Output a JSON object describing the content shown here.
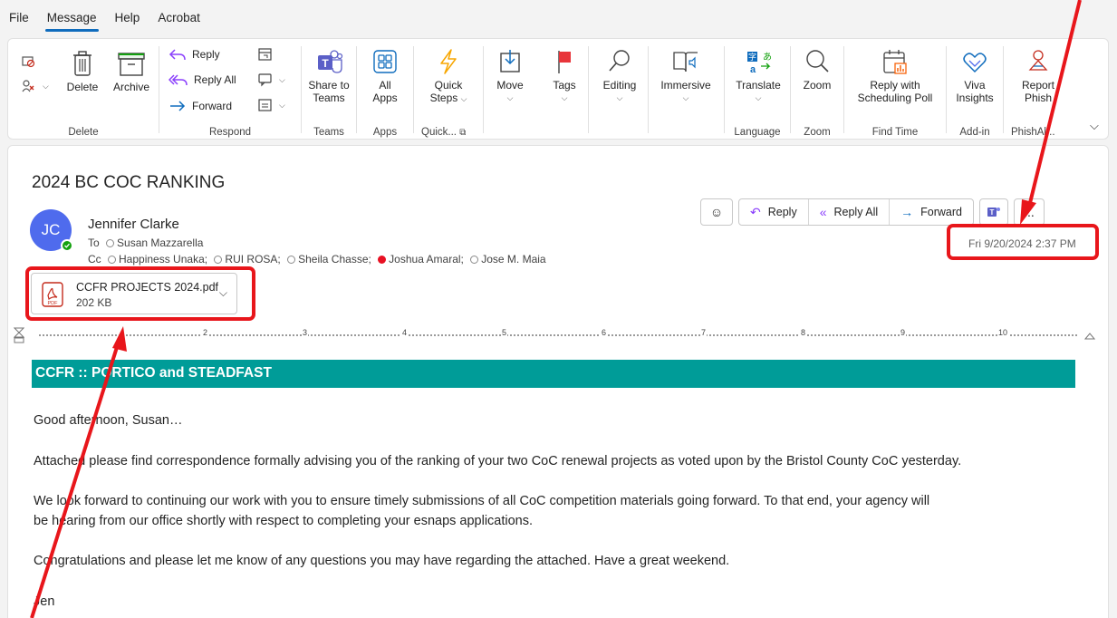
{
  "menu": {
    "tabs": [
      "File",
      "Message",
      "Help",
      "Acrobat"
    ],
    "active": "Message"
  },
  "ribbon": {
    "groups": {
      "delete": "Delete",
      "respond": "Respond",
      "teams": "Teams",
      "apps": "Apps",
      "quick": "Quick...",
      "language": "Language",
      "zoom": "Zoom",
      "findtime": "Find Time",
      "addin": "Add-in",
      "phish": "PhishAl..."
    },
    "buttons": {
      "delete": "Delete",
      "archive": "Archive",
      "reply": "Reply",
      "reply_all": "Reply All",
      "forward": "Forward",
      "share_teams_1": "Share to",
      "share_teams_2": "Teams",
      "all_apps_1": "All",
      "all_apps_2": "Apps",
      "quick_steps_1": "Quick",
      "quick_steps_2": "Steps",
      "move": "Move",
      "tags": "Tags",
      "editing": "Editing",
      "immersive": "Immersive",
      "translate": "Translate",
      "zoom": "Zoom",
      "reply_poll_1": "Reply with",
      "reply_poll_2": "Scheduling Poll",
      "viva_1": "Viva",
      "viva_2": "Insights",
      "report_1": "Report",
      "report_2": "Phish"
    },
    "colors": {
      "accent": "#0f6cbd",
      "teal_banner": "#009c98",
      "annotation_red": "#e8161b"
    }
  },
  "message": {
    "subject": "2024 BC COC RANKING",
    "sender": "Jennifer Clarke",
    "avatar_initials": "JC",
    "to_label": "To",
    "to": [
      "Susan Mazzarella"
    ],
    "cc_label": "Cc",
    "cc": [
      "Happiness Unaka;",
      "RUI ROSA;",
      "Sheila Chasse;",
      "Joshua Amaral;",
      "Jose M. Maia"
    ],
    "date": "Fri 9/20/2024 2:37 PM",
    "actions": {
      "reply": "Reply",
      "reply_all": "Reply All",
      "forward": "Forward",
      "more": "..."
    },
    "attachment": {
      "name": "CCFR PROJECTS 2024.pdf",
      "size": "202 KB",
      "icon_label": "PDF"
    },
    "ruler_numbers": [
      "2",
      "3",
      "4",
      "5",
      "6",
      "7",
      "8",
      "9",
      "10"
    ],
    "banner": "CCFR :: PORTICO and STEADFAST",
    "body": {
      "greeting": "Good afternoon, Susan…",
      "p1": "Attached please find correspondence formally advising you of the ranking of your two CoC renewal projects as voted upon by the Bristol County CoC yesterday.",
      "p2a": "We look forward to continuing our work with you to ensure timely submissions of all CoC competition materials going forward. To that end, your agency will",
      "p2b": "be hearing from our office shortly with respect to completing your esnaps applications.",
      "p3": "Congratulations and please let me know of any questions you may have regarding the attached. Have a great weekend.",
      "signoff": "Jen"
    }
  }
}
